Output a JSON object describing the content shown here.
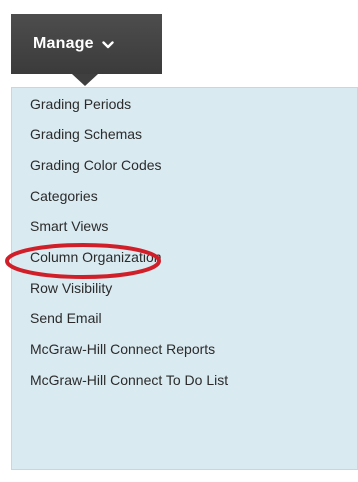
{
  "manage_button": {
    "label": "Manage",
    "icon": "chevron-down-icon"
  },
  "menu": {
    "items": [
      {
        "label": "Grading Periods"
      },
      {
        "label": "Grading Schemas"
      },
      {
        "label": "Grading Color Codes"
      },
      {
        "label": "Categories"
      },
      {
        "label": "Smart Views"
      },
      {
        "label": "Column Organization"
      },
      {
        "label": "Row Visibility"
      },
      {
        "label": "Send Email"
      },
      {
        "label": "McGraw-Hill Connect Reports"
      },
      {
        "label": "McGraw-Hill Connect To Do List"
      }
    ]
  },
  "annotation": {
    "highlight_color": "#d11f2a"
  }
}
